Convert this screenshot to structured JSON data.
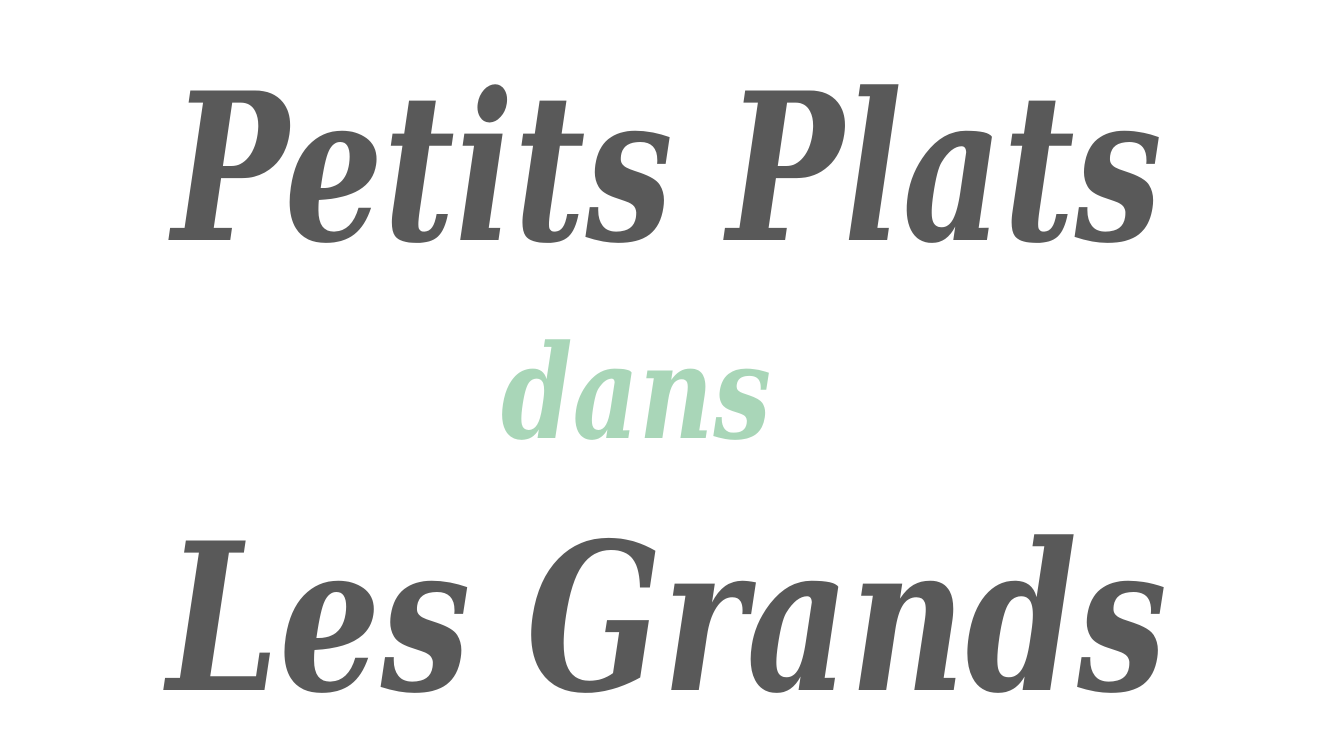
{
  "logo": {
    "line1": "Petits Plats",
    "line2": "dans",
    "line3": "Les Grands"
  },
  "colors": {
    "background": "#ffffff",
    "main_text": "#595959",
    "accent_text": "#a9d6b8"
  }
}
